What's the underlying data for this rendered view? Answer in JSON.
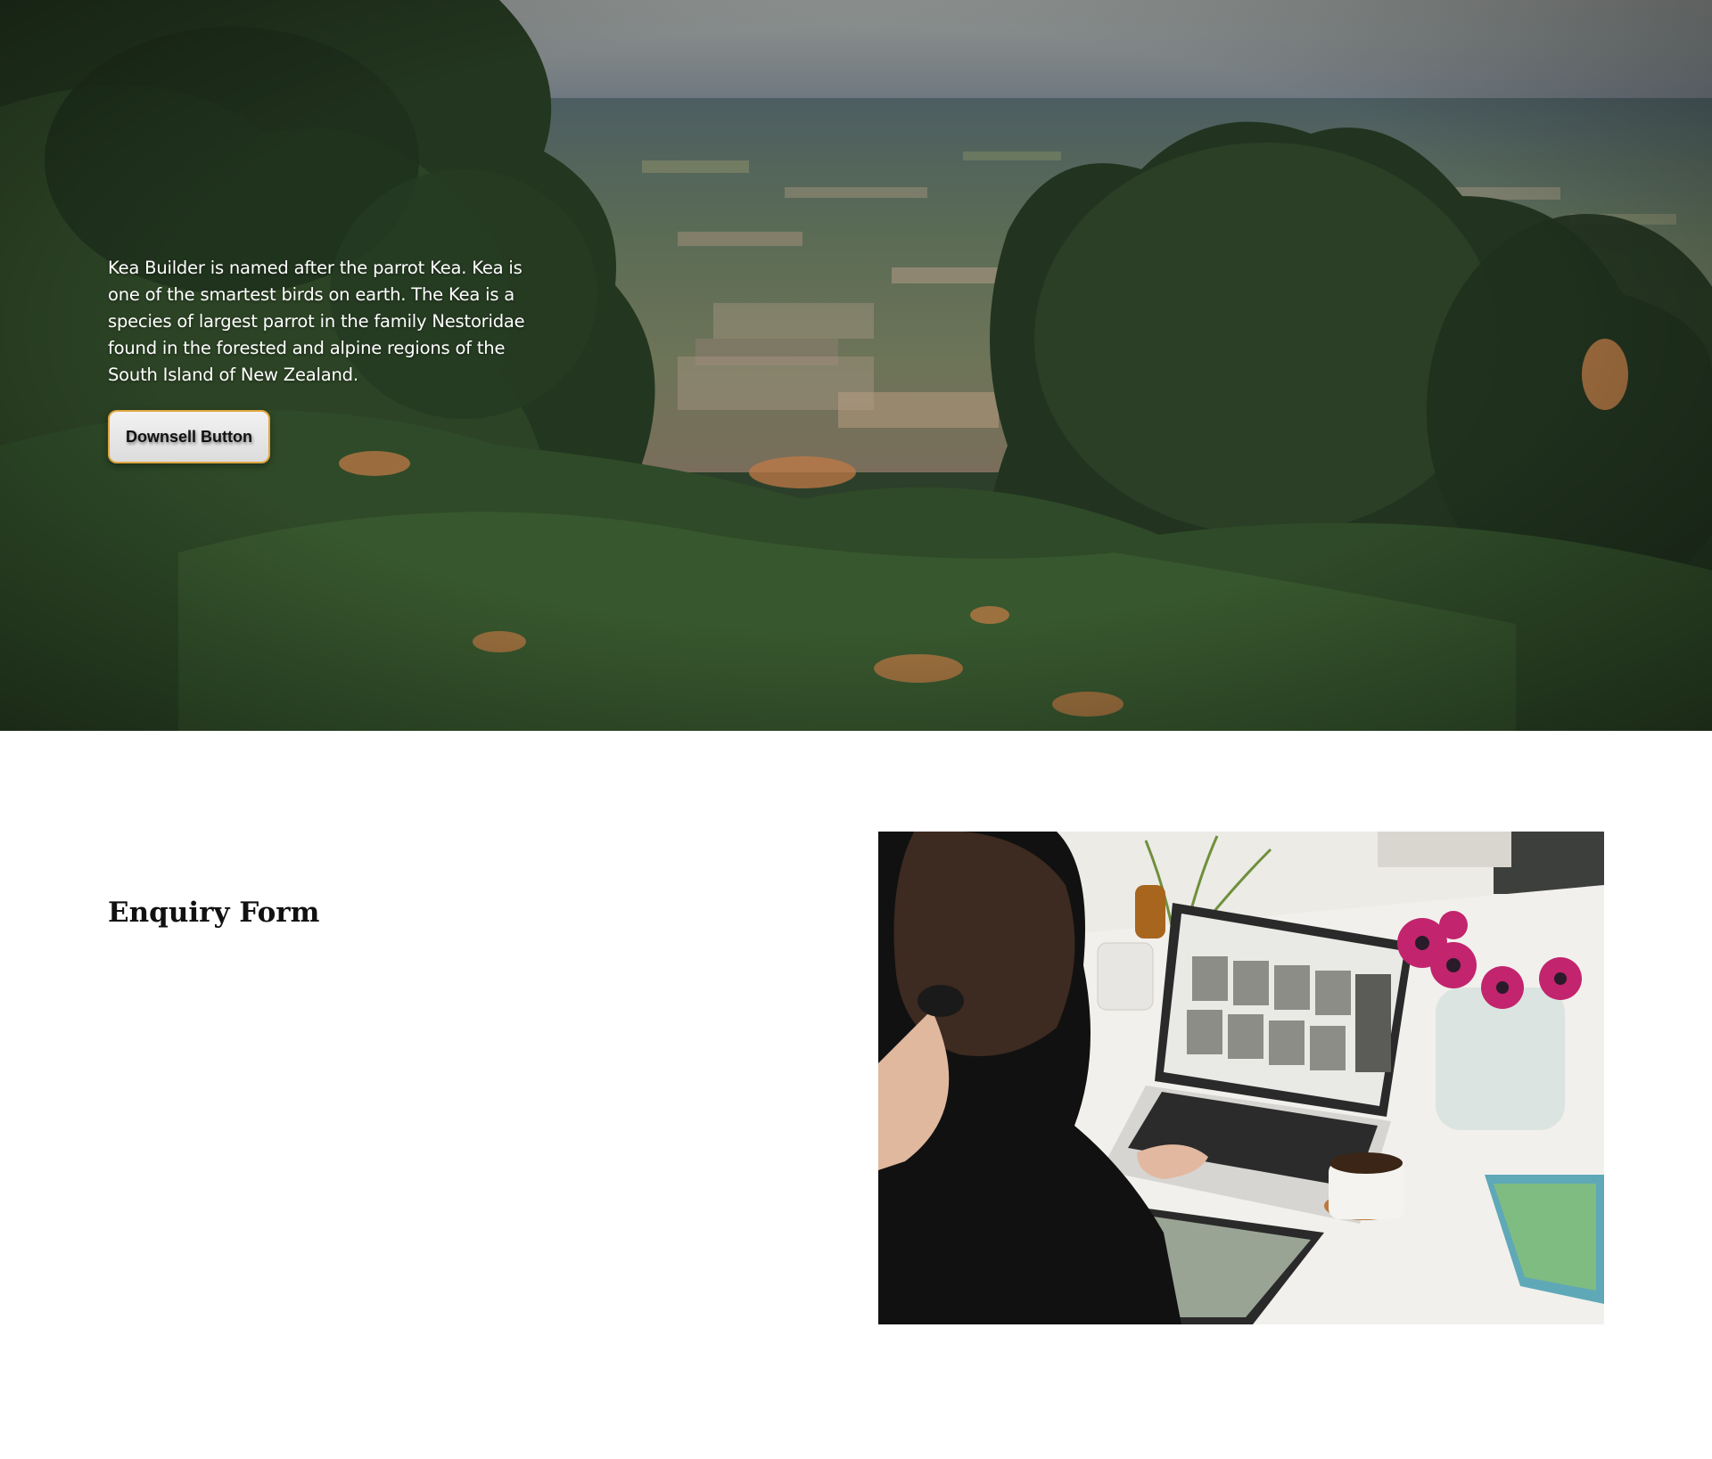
{
  "hero": {
    "description": "Kea Builder is named after the parrot Kea. Kea is one of the smartest birds on earth. The Kea is a species of largest parrot in the family Nestoridae found in the forested and alpine regions of the South Island of New Zealand.",
    "button_label": "Downsell Button",
    "colors": {
      "button_border": "#e0a640",
      "text": "#ffffff"
    }
  },
  "form_section": {
    "title": "Enquiry Form"
  }
}
